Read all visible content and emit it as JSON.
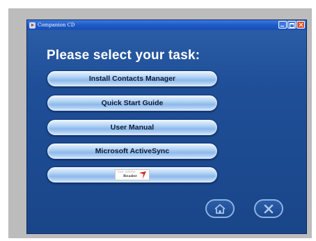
{
  "window": {
    "title": "Companion CD"
  },
  "main": {
    "heading": "Please select your task:",
    "buttons": [
      {
        "label": "Install Contacts Manager"
      },
      {
        "label": "Quick Start Guide"
      },
      {
        "label": "User Manual"
      },
      {
        "label": "Microsoft ActiveSync"
      },
      {
        "label": "",
        "logo_line1": "Get Adobe",
        "logo_line2": "Reader"
      }
    ]
  },
  "nav": {
    "home_icon": "home-icon",
    "exit_icon": "close-icon"
  },
  "colors": {
    "window_bg": "#1f4f98",
    "button_face": "#b9d7f6",
    "titlebar": "#1f5ac6"
  }
}
